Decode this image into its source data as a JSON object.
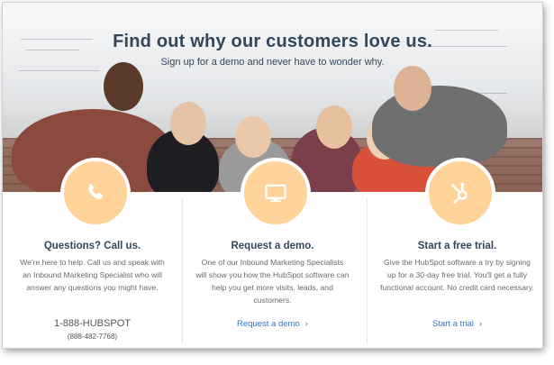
{
  "hero": {
    "title": "Find out why our customers love us.",
    "subtitle": "Sign up for a demo and never have to wonder why."
  },
  "columns": [
    {
      "icon": "phone-icon",
      "title": "Questions? Call us.",
      "body": "We're here to help. Call us and speak with an Inbound Marketing Specialist who will answer any questions you might have.",
      "phone": "1-888-HUBSPOT",
      "phone_numeric": "(888-482-7768)"
    },
    {
      "icon": "monitor-icon",
      "title": "Request a demo.",
      "body": "One of our Inbound Marketing Specialists will show you how the HubSpot software can help you get more visits, leads, and customers.",
      "link": "Request a demo",
      "chevron": "›"
    },
    {
      "icon": "hubspot-sprocket-icon",
      "title": "Start a free trial.",
      "body": "Give the HubSpot software a try by signing up for a 30-day free trial. You'll get a fully functional account. No credit card necessary.",
      "link": "Start a trial",
      "chevron": "›"
    }
  ],
  "colors": {
    "heading": "#33475b",
    "icon_circle": "#ffd39a",
    "link": "#2f78c4"
  }
}
